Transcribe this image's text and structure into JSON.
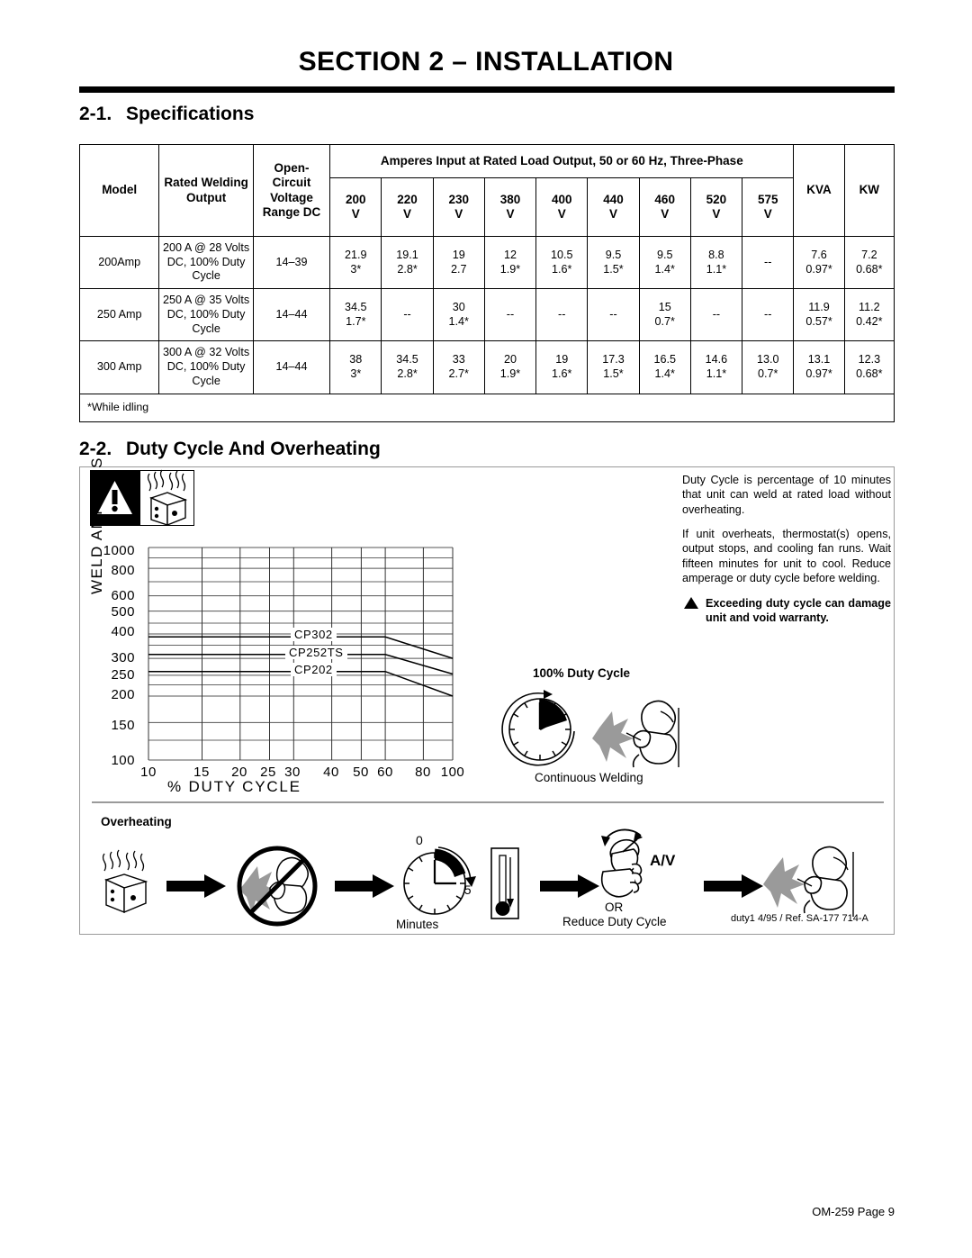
{
  "header": {
    "section_title": "SECTION 2 – INSTALLATION",
    "footer": "OM-259 Page 9"
  },
  "sections": [
    {
      "number": "2-1.",
      "title": "Specifications"
    },
    {
      "number": "2-2.",
      "title": "Duty Cycle And Overheating"
    }
  ],
  "spec_table": {
    "group_header": "Amperes Input at Rated Load Output, 50 or 60 Hz, Three-Phase",
    "headers": {
      "model": "Model",
      "rated_output": "Rated Welding Output",
      "ocv": "Open- Circuit Voltage Range DC",
      "kva": "KVA",
      "kw": "KW"
    },
    "volt_columns": [
      "200",
      "220",
      "230",
      "380",
      "400",
      "440",
      "460",
      "520",
      "575"
    ],
    "volt_unit": "V",
    "rows": [
      {
        "model": "200Amp",
        "rated_output": "200 A @ 28 Volts DC, 100% Duty Cycle",
        "ocv": "14–39",
        "amps": [
          {
            "top": "21.9",
            "bot": "3*"
          },
          {
            "top": "19.1",
            "bot": "2.8*"
          },
          {
            "top": "19",
            "bot": "2.7"
          },
          {
            "top": "12",
            "bot": "1.9*"
          },
          {
            "top": "10.5",
            "bot": "1.6*"
          },
          {
            "top": "9.5",
            "bot": "1.5*"
          },
          {
            "top": "9.5",
            "bot": "1.4*"
          },
          {
            "top": "8.8",
            "bot": "1.1*"
          },
          {
            "top": "--",
            "bot": ""
          }
        ],
        "kva": {
          "top": "7.6",
          "bot": "0.97*"
        },
        "kw": {
          "top": "7.2",
          "bot": "0.68*"
        }
      },
      {
        "model": "250 Amp",
        "rated_output": "250 A @ 35 Volts DC, 100% Duty Cycle",
        "ocv": "14–44",
        "amps": [
          {
            "top": "34.5",
            "bot": "1.7*"
          },
          {
            "top": "--",
            "bot": ""
          },
          {
            "top": "30",
            "bot": "1.4*"
          },
          {
            "top": "--",
            "bot": ""
          },
          {
            "top": "--",
            "bot": ""
          },
          {
            "top": "--",
            "bot": ""
          },
          {
            "top": "15",
            "bot": "0.7*"
          },
          {
            "top": "--",
            "bot": ""
          },
          {
            "top": "--",
            "bot": ""
          }
        ],
        "kva": {
          "top": "11.9",
          "bot": "0.57*"
        },
        "kw": {
          "top": "11.2",
          "bot": "0.42*"
        }
      },
      {
        "model": "300 Amp",
        "rated_output": "300 A @ 32 Volts DC, 100% Duty Cycle",
        "ocv": "14–44",
        "amps": [
          {
            "top": "38",
            "bot": "3*"
          },
          {
            "top": "34.5",
            "bot": "2.8*"
          },
          {
            "top": "33",
            "bot": "2.7*"
          },
          {
            "top": "20",
            "bot": "1.9*"
          },
          {
            "top": "19",
            "bot": "1.6*"
          },
          {
            "top": "17.3",
            "bot": "1.5*"
          },
          {
            "top": "16.5",
            "bot": "1.4*"
          },
          {
            "top": "14.6",
            "bot": "1.1*"
          },
          {
            "top": "13.0",
            "bot": "0.7*"
          }
        ],
        "kva": {
          "top": "13.1",
          "bot": "0.97*"
        },
        "kw": {
          "top": "12.3",
          "bot": "0.68*"
        }
      }
    ],
    "footnote": "*While idling"
  },
  "duty_cycle": {
    "paragraph_1": "Duty Cycle is percentage of 10 minutes that unit can weld at rated load without overheating.",
    "paragraph_2": "If unit overheats, thermostat(s) opens, output stops, and cooling fan runs. Wait fifteen minutes for unit to cool. Reduce amperage or duty cycle before welding.",
    "warning": "Exceeding duty cycle can damage unit and void warranty.",
    "dc100_caption": "100% Duty Cycle",
    "continuous_welding": "Continuous Welding",
    "overheating_caption": "Overheating",
    "minutes_caption": "Minutes",
    "clock_zero": "0",
    "clock_fifteen": "15",
    "av_label": "A/V",
    "or_label": "OR",
    "reduce_duty_cycle": "Reduce Duty Cycle",
    "reference": "duty1 4/95 / Ref. SA-177 714-A"
  },
  "chart_data": {
    "type": "line",
    "title": "",
    "xlabel": "% DUTY CYCLE",
    "ylabel": "WELD AMPERES",
    "xscale": "log",
    "yscale": "log",
    "xlim": [
      10,
      100
    ],
    "ylim": [
      100,
      1000
    ],
    "xticks": [
      10,
      15,
      20,
      25,
      30,
      40,
      50,
      60,
      80,
      100
    ],
    "yticks": [
      100,
      150,
      200,
      250,
      300,
      400,
      500,
      600,
      800,
      1000
    ],
    "grid": true,
    "legend": "inline-labels",
    "series": [
      {
        "name": "CP302",
        "x": [
          10,
          60,
          100
        ],
        "y": [
          380,
          380,
          300
        ]
      },
      {
        "name": "CP252TS",
        "x": [
          10,
          60,
          100
        ],
        "y": [
          315,
          315,
          255
        ]
      },
      {
        "name": "CP202",
        "x": [
          10,
          60,
          100
        ],
        "y": [
          260,
          260,
          200
        ]
      }
    ]
  }
}
